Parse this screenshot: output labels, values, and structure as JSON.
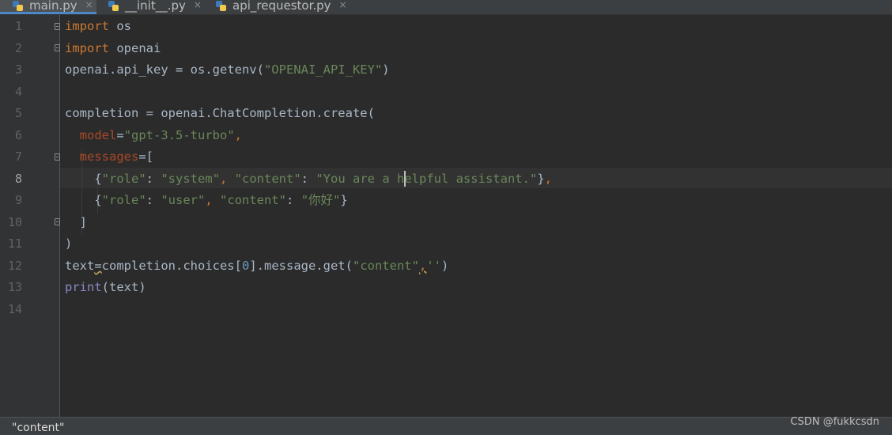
{
  "tabs": [
    {
      "label": "main.py",
      "active": true,
      "icon": "python-file-icon"
    },
    {
      "label": "__init__.py",
      "active": false,
      "icon": "python-file-icon"
    },
    {
      "label": "api_requestor.py",
      "active": false,
      "icon": "python-file-icon"
    }
  ],
  "tab_close_glyph": "×",
  "editor": {
    "line_numbers": [
      "1",
      "2",
      "3",
      "4",
      "5",
      "6",
      "7",
      "8",
      "9",
      "10",
      "11",
      "12",
      "13",
      "14"
    ],
    "current_line": 8,
    "lines": [
      "import os",
      "import openai",
      "openai.api_key = os.getenv(\"OPENAI_API_KEY\")",
      "",
      "completion = openai.ChatCompletion.create(",
      "  model=\"gpt-3.5-turbo\",",
      "  messages=[",
      "    {\"role\": \"system\", \"content\": \"You are a helpful assistant.\"},",
      "    {\"role\": \"user\", \"content\": \"你好\"}",
      "  ]",
      ")",
      "text=completion.choices[0].message.get(\"content\",'')",
      "print(text)",
      ""
    ]
  },
  "status_bar": {
    "hint": "\"content\""
  },
  "watermark": "CSDN @fukkcsdn",
  "colors": {
    "background": "#2b2b2b",
    "keyword": "#cc7832",
    "string": "#6a8759",
    "number": "#6897bb",
    "parameter": "#aa4926",
    "builtin": "#8888c6",
    "identifier": "#a9b7c6"
  }
}
